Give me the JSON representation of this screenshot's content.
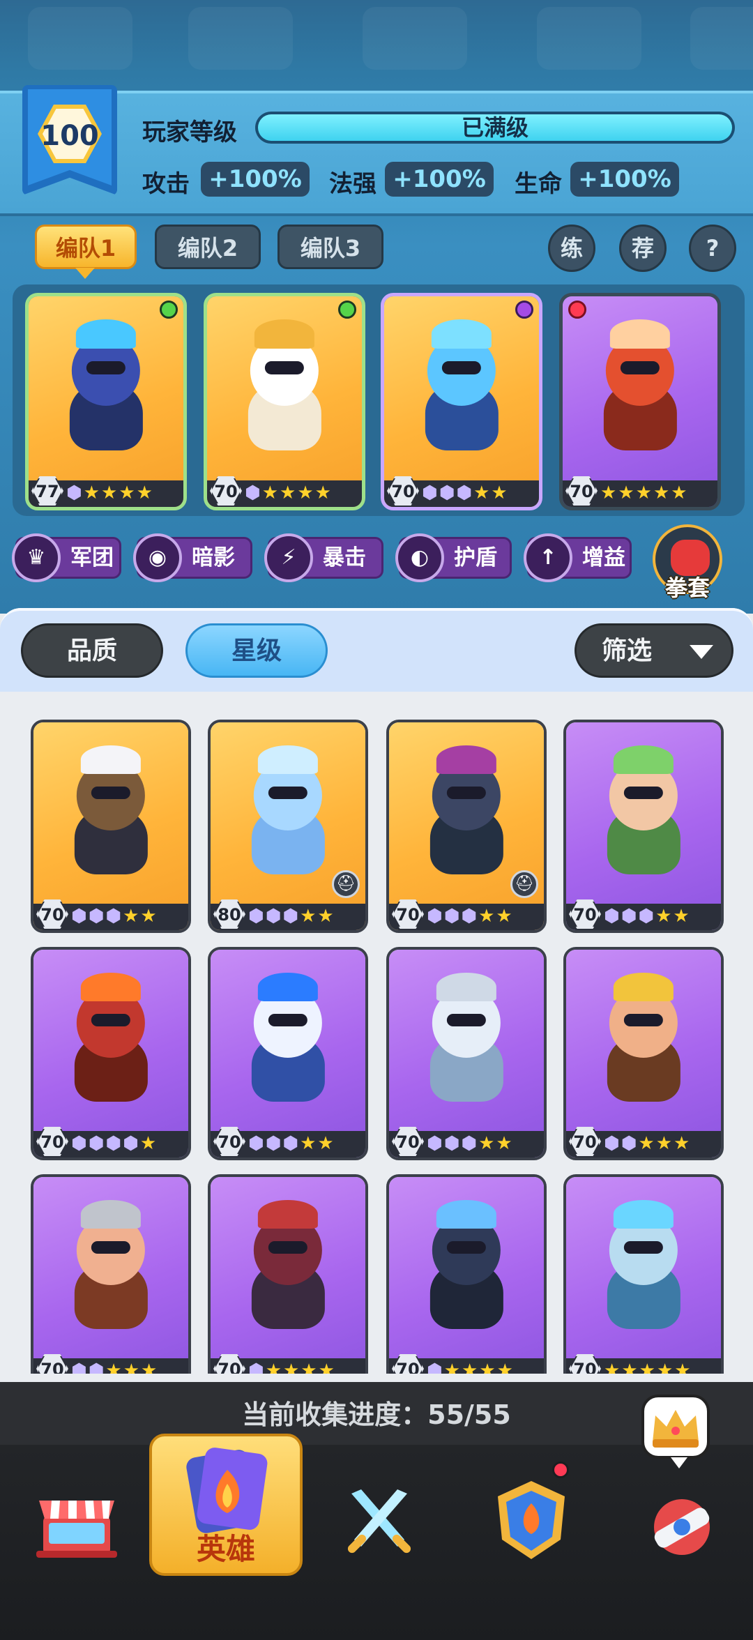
{
  "player": {
    "level": "100",
    "level_label": "玩家等级",
    "xp_text": "已满级",
    "xp_progress": 1.0,
    "stats": [
      {
        "label": "攻击",
        "value": "+100%"
      },
      {
        "label": "法强",
        "value": "+100%"
      },
      {
        "label": "生命",
        "value": "+100%"
      }
    ]
  },
  "teams": {
    "tabs": [
      "编队1",
      "编队2",
      "编队3"
    ],
    "active_index": 0,
    "buttons": [
      "练",
      "荐",
      "?"
    ]
  },
  "team_heroes": [
    {
      "level": "77",
      "bg": "gold",
      "gems": 1,
      "gold_stars": 4,
      "dot": "green"
    },
    {
      "level": "70",
      "bg": "gold",
      "gems": 1,
      "gold_stars": 4,
      "dot": "green"
    },
    {
      "level": "70",
      "bg": "gold",
      "gems": 3,
      "gold_stars": 2,
      "dot": "purple"
    },
    {
      "level": "70",
      "bg": "purple",
      "gems": 0,
      "gold_stars": 5,
      "dot": "red"
    }
  ],
  "traits": [
    {
      "label": "军团",
      "icon": "legion-icon"
    },
    {
      "label": "暗影",
      "icon": "shadow-icon"
    },
    {
      "label": "暴击",
      "icon": "crit-icon"
    },
    {
      "label": "护盾",
      "icon": "shield-icon"
    },
    {
      "label": "增益",
      "icon": "buff-icon"
    }
  ],
  "gloves_label": "拳套",
  "filter": {
    "quality": "品质",
    "star": "星级",
    "filter": "筛选"
  },
  "heroes": [
    {
      "level": "70",
      "bg": "gold",
      "gems": 3,
      "gold_stars": 2,
      "helmet": false
    },
    {
      "level": "80",
      "bg": "gold",
      "gems": 3,
      "gold_stars": 2,
      "helmet": true
    },
    {
      "level": "70",
      "bg": "gold",
      "gems": 3,
      "gold_stars": 2,
      "helmet": true
    },
    {
      "level": "70",
      "bg": "purple",
      "gems": 3,
      "gold_stars": 2,
      "helmet": false
    },
    {
      "level": "70",
      "bg": "purple",
      "gems": 4,
      "gold_stars": 1,
      "helmet": false
    },
    {
      "level": "70",
      "bg": "purple",
      "gems": 3,
      "gold_stars": 2,
      "helmet": false
    },
    {
      "level": "70",
      "bg": "purple",
      "gems": 3,
      "gold_stars": 2,
      "helmet": false
    },
    {
      "level": "70",
      "bg": "purple",
      "gems": 2,
      "gold_stars": 3,
      "helmet": false
    },
    {
      "level": "70",
      "bg": "purple",
      "gems": 2,
      "gold_stars": 3,
      "helmet": false
    },
    {
      "level": "70",
      "bg": "purple",
      "gems": 1,
      "gold_stars": 4,
      "helmet": false
    },
    {
      "level": "70",
      "bg": "purple",
      "gems": 1,
      "gold_stars": 4,
      "helmet": false
    },
    {
      "level": "70",
      "bg": "purple",
      "gems": 0,
      "gold_stars": 5,
      "helmet": false
    }
  ],
  "collection": {
    "text": "当前收集进度：55/55"
  },
  "nav": {
    "items": [
      "shop-icon",
      "hero-icon",
      "battle-icon",
      "guild-icon",
      "gacha-icon"
    ],
    "active_label": "英雄"
  },
  "colors": {
    "gold_star": "#ffd12b",
    "gem_star": "#c6b8ff",
    "accent_blue": "#48b6f4",
    "accent_orange": "#f4b02a"
  }
}
